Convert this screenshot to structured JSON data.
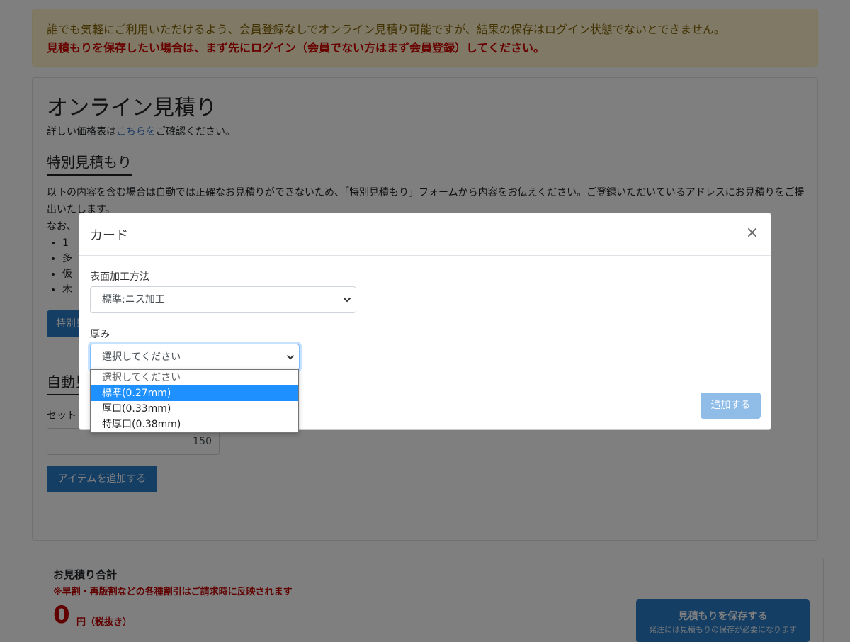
{
  "notice": {
    "line1": "誰でも気軽にご利用いただけるよう、会員登録なしでオンライン見積り可能ですが、結果の保存はログイン状態でないとできません。",
    "line2": "見積もりを保存したい場合は、まず先にログイン（会員でない方はまず会員登録）してください。"
  },
  "main": {
    "title": "オンライン見積り",
    "lead_prefix": "詳しい価格表は",
    "lead_link": "こちらを",
    "lead_suffix": "ご確認ください。",
    "special_title": "特別見積もり",
    "special_text": "以下の内容を含む場合は自動では正確なお見積りができないため、「特別見積もり」フォームから内容をお伝えください。ご登録いただいているアドレスにお見積りをご提出いたします。",
    "special_text2": "なお、",
    "bullets": [
      "1",
      "多",
      "仮",
      "木"
    ],
    "special_button": "特別見",
    "auto_title": "自動見",
    "set_label": "セット",
    "quantity_value": "150",
    "add_item_button": "アイテムを追加する"
  },
  "total": {
    "title": "お見積り合計",
    "note": "※早割・再版割などの各種割引はご請求時に反映されます",
    "amount": "0",
    "unit": "円（税抜き）",
    "save_button_main": "見積もりを保存する",
    "save_button_sub": "発注には見積もりの保存が必要になります"
  },
  "modal": {
    "title": "カード",
    "close_symbol": "×",
    "finish_label": "表面加工方法",
    "finish_selected": "標準:ニス加工",
    "thickness_label": "厚み",
    "thickness_selected": "選択してください",
    "thickness_options": [
      "選択してください",
      "標準(0.27mm)",
      "厚口(0.33mm)",
      "特厚口(0.38mm)"
    ],
    "highlighted_option_index": 1,
    "add_button": "追加する"
  },
  "colors": {
    "accent": "#2a7dc9",
    "alert_red": "#d00000",
    "highlight": "#1e90ff"
  }
}
